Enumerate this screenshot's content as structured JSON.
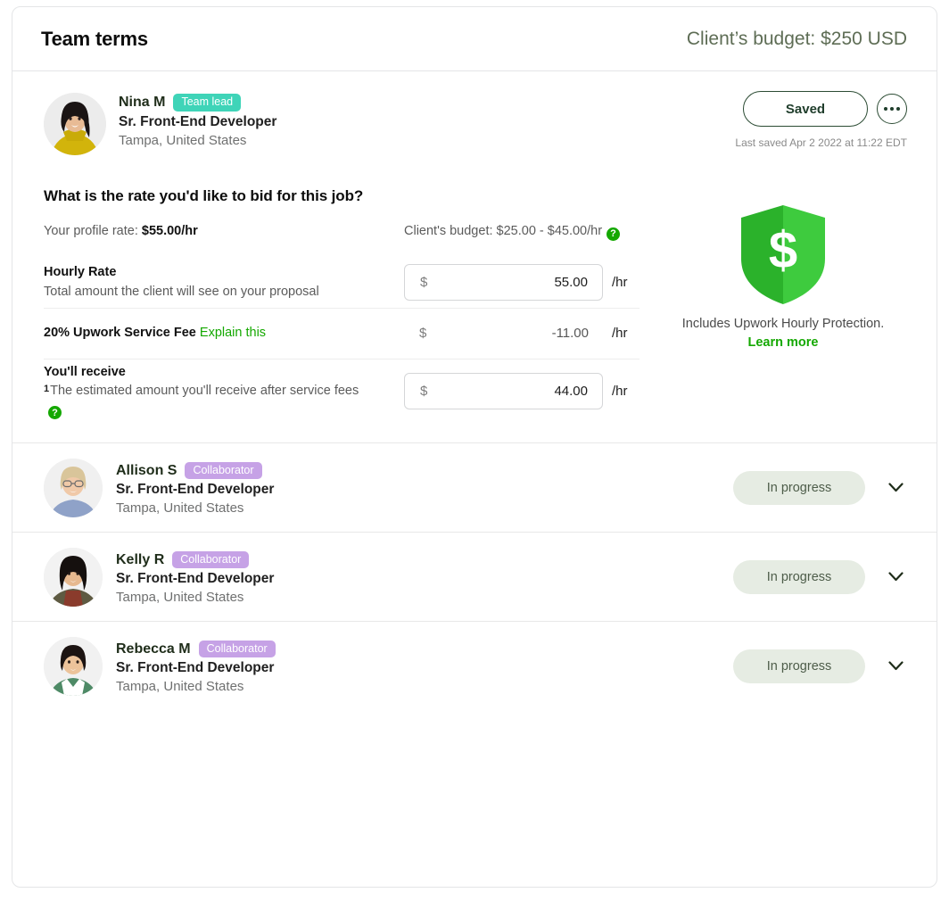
{
  "header": {
    "title": "Team terms",
    "budget_note": "Client’s budget: $250 USD"
  },
  "lead": {
    "name": "Nina M",
    "badge": "Team lead",
    "badge_color": "#3fd4b8",
    "role": "Sr. Front-End Developer",
    "location": "Tampa, United States",
    "save_button": "Saved",
    "more_icon": "ellipsis-icon",
    "last_saved": "Last saved Apr 2 2022 at 11:22 EDT"
  },
  "rate": {
    "question": "What is the rate you'd like to bid for this job?",
    "profile_rate_label": "Your profile rate: ",
    "profile_rate_value": "$55.00/hr",
    "client_budget_label": "Client's budget: ",
    "client_budget_value": "$25.00 - $45.00/hr",
    "help_icon": "?",
    "rows": [
      {
        "title": "Hourly Rate",
        "subtitle": "Total amount the client will see on your proposal",
        "currency": "$",
        "value": "55.00",
        "unit": "/hr",
        "boxed": true
      },
      {
        "title": "20% Upwork Service Fee",
        "link": "Explain this",
        "currency": "$",
        "value": "-11.00",
        "unit": "/hr",
        "boxed": false
      },
      {
        "title": "You'll receive",
        "footnote_marker": "1",
        "subtitle": "The estimated amount you'll receive after service fees",
        "currency": "$",
        "value": "44.00",
        "unit": "/hr",
        "boxed": true
      }
    ]
  },
  "protection": {
    "icon": "shield-dollar-icon",
    "caption": "Includes Upwork Hourly Protection.",
    "link": "Learn more",
    "shield_color_dark": "#2bb22b",
    "shield_color_light": "#3ecb3e",
    "link_color": "#14a800"
  },
  "collaborators": [
    {
      "name": "Allison S",
      "badge": "Collaborator",
      "role": "Sr. Front-End Developer",
      "location": "Tampa, United States",
      "status": "In progress",
      "chevron_icon": "chevron-down-icon"
    },
    {
      "name": "Kelly R",
      "badge": "Collaborator",
      "role": "Sr. Front-End Developer",
      "location": "Tampa, United States",
      "status": "In progress",
      "chevron_icon": "chevron-down-icon"
    },
    {
      "name": "Rebecca M",
      "badge": "Collaborator",
      "role": "Sr. Front-End Developer",
      "location": "Tampa, United States",
      "status": "In progress",
      "chevron_icon": "chevron-down-icon"
    }
  ],
  "badge_colors": {
    "collaborator": "#c6a2e6",
    "status_pill": "#e6ece3"
  }
}
